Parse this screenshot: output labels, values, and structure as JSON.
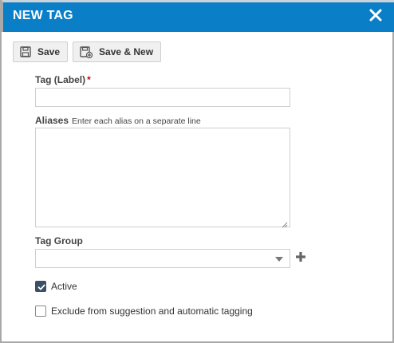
{
  "dialog": {
    "title": "NEW TAG",
    "accent_color": "#0a7fc8",
    "close_icon": "close-x-icon"
  },
  "toolbar": {
    "save_label": "Save",
    "save_new_label": "Save & New",
    "save_icon": "floppy-disk-icon",
    "save_new_icon": "floppy-disk-plus-icon"
  },
  "form": {
    "tag_label": "Tag (Label)",
    "required_mark": "*",
    "tag_value": "",
    "aliases_label": "Aliases",
    "aliases_hint": "Enter each alias on a separate line",
    "aliases_value": "",
    "tag_group_label": "Tag Group",
    "tag_group_value": "",
    "add_group_icon": "plus-icon",
    "active_label": "Active",
    "active_checked": true,
    "exclude_label": "Exclude from suggestion and automatic tagging",
    "exclude_checked": false
  }
}
